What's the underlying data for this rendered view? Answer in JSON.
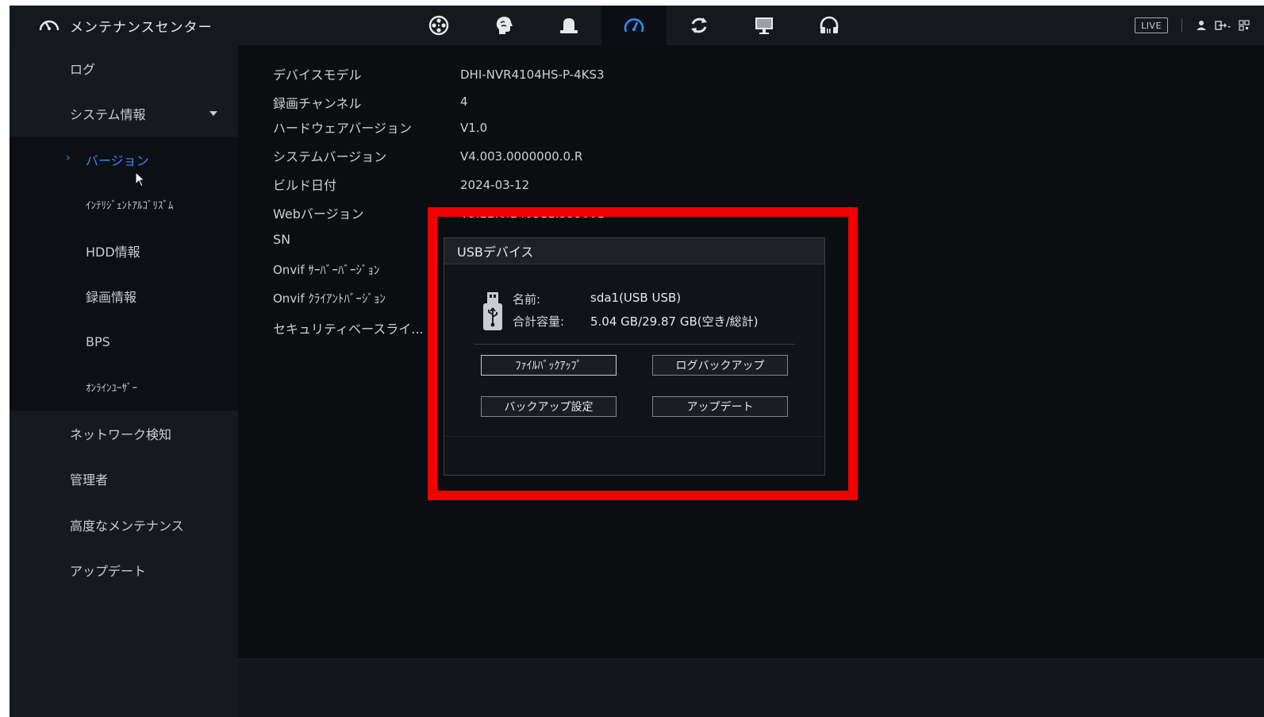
{
  "header": {
    "title": "メンテナンスセンター",
    "live_label": "LIVE",
    "nav_icons": [
      "film-reel-icon",
      "brain-icon",
      "alarm-bell-icon",
      "gauge-icon",
      "sync-icon",
      "monitor-icon",
      "headset-icon"
    ]
  },
  "sidebar": {
    "items": [
      {
        "label": "ログ"
      },
      {
        "label": "システム情報"
      },
      {
        "label": "バージョン"
      },
      {
        "label": "ｲﾝﾃﾘｼﾞｪﾝﾄｱﾙｺﾞﾘｽﾞﾑ"
      },
      {
        "label": "HDD情報"
      },
      {
        "label": "録画情報"
      },
      {
        "label": "BPS"
      },
      {
        "label": "ｵﾝﾗｲﾝﾕｰｻﾞｰ"
      },
      {
        "label": "ネットワーク検知"
      },
      {
        "label": "管理者"
      },
      {
        "label": "高度なメンテナンス"
      },
      {
        "label": "アップデート"
      }
    ],
    "active_chevron": "›"
  },
  "info": {
    "rows": [
      {
        "label": "デバイスモデル",
        "value": "DHI-NVR4104HS-P-4KS3"
      },
      {
        "label": "録画チャンネル",
        "value": "4"
      },
      {
        "label": "ハードウェアバージョン",
        "value": "V1.0"
      },
      {
        "label": "システムバージョン",
        "value": "V4.003.0000000.0.R"
      },
      {
        "label": "ビルド日付",
        "value": "2024-03-12"
      },
      {
        "label": "Webバージョン",
        "value": "V5.22.0.240312.553001"
      },
      {
        "label": "SN",
        "value": ""
      },
      {
        "label": "Onvif ｻｰﾊﾞｰﾊﾞｰｼﾞｮﾝ",
        "value": ""
      },
      {
        "label": "Onvif ｸﾗｲｱﾝﾄﾊﾞｰｼﾞｮﾝ",
        "value": ""
      },
      {
        "label": "セキュリティベースライ...",
        "value": ""
      }
    ]
  },
  "usb_dialog": {
    "title": "USBデバイス",
    "name_label": "名前:",
    "name_value": "sda1(USB USB)",
    "capacity_label": "合計容量:",
    "capacity_value": "5.04 GB/29.87 GB(空き/総計)",
    "buttons": {
      "file_backup": "ﾌｧｲﾙﾊﾞｯｸｱｯﾌﾟ",
      "log_backup": "ログバックアップ",
      "backup_settings": "バックアップ設定",
      "update": "アップデート"
    }
  },
  "colors": {
    "accent": "#2f8dff",
    "highlight": "#f20000",
    "background": "#0b0d10",
    "sidebar": "#161a1f"
  }
}
